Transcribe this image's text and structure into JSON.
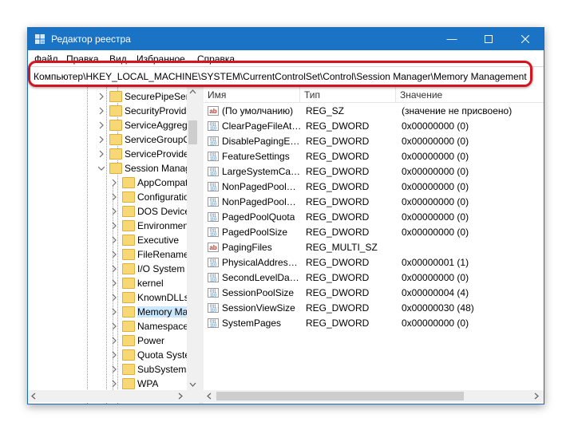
{
  "window": {
    "title": "Редактор реестра"
  },
  "menu": {
    "items": [
      "Файл",
      "Правка",
      "Вид",
      "Избранное",
      "Справка"
    ]
  },
  "address": {
    "path": "Компьютер\\HKEY_LOCAL_MACHINE\\SYSTEM\\CurrentControlSet\\Control\\Session Manager\\Memory Management"
  },
  "tree": {
    "items": [
      {
        "label": "SecurePipeServers"
      },
      {
        "label": "SecurityProviders"
      },
      {
        "label": "ServiceAggregatedEvents"
      },
      {
        "label": "ServiceGroupOrder"
      },
      {
        "label": "ServiceProvider"
      },
      {
        "label": "Session Manager"
      },
      {
        "label": "AppCompatCache"
      },
      {
        "label": "Configuration Manager"
      },
      {
        "label": "DOS Devices"
      },
      {
        "label": "Environment"
      },
      {
        "label": "Executive"
      },
      {
        "label": "FileRenameOperations"
      },
      {
        "label": "I/O System"
      },
      {
        "label": "kernel"
      },
      {
        "label": "KnownDLLs"
      },
      {
        "label": "Memory Management"
      },
      {
        "label": "Namespace Separation"
      },
      {
        "label": "Power"
      },
      {
        "label": "Quota System"
      },
      {
        "label": "SubSystems"
      },
      {
        "label": "WPA"
      }
    ]
  },
  "list": {
    "columns": {
      "name": "Имя",
      "type": "Тип",
      "value": "Значение"
    },
    "rows": [
      {
        "icon": "string-value-icon",
        "name": "(По умолчанию)",
        "type": "REG_SZ",
        "value": "(значение не присвоено)"
      },
      {
        "icon": "binary-value-icon",
        "name": "ClearPageFileAtShutdown",
        "type": "REG_DWORD",
        "value": "0x00000000 (0)"
      },
      {
        "icon": "binary-value-icon",
        "name": "DisablePagingExecutive",
        "type": "REG_DWORD",
        "value": "0x00000000 (0)"
      },
      {
        "icon": "binary-value-icon",
        "name": "FeatureSettings",
        "type": "REG_DWORD",
        "value": "0x00000000 (0)"
      },
      {
        "icon": "binary-value-icon",
        "name": "LargeSystemCache",
        "type": "REG_DWORD",
        "value": "0x00000000 (0)"
      },
      {
        "icon": "binary-value-icon",
        "name": "NonPagedPoolQuota",
        "type": "REG_DWORD",
        "value": "0x00000000 (0)"
      },
      {
        "icon": "binary-value-icon",
        "name": "NonPagedPoolSize",
        "type": "REG_DWORD",
        "value": "0x00000000 (0)"
      },
      {
        "icon": "binary-value-icon",
        "name": "PagedPoolQuota",
        "type": "REG_DWORD",
        "value": "0x00000000 (0)"
      },
      {
        "icon": "binary-value-icon",
        "name": "PagedPoolSize",
        "type": "REG_DWORD",
        "value": "0x00000000 (0)"
      },
      {
        "icon": "string-value-icon",
        "name": "PagingFiles",
        "type": "REG_MULTI_SZ",
        "value": ""
      },
      {
        "icon": "binary-value-icon",
        "name": "PhysicalAddressExtension",
        "type": "REG_DWORD",
        "value": "0x00000001 (1)"
      },
      {
        "icon": "binary-value-icon",
        "name": "SecondLevelDataCache",
        "type": "REG_DWORD",
        "value": "0x00000000 (0)"
      },
      {
        "icon": "binary-value-icon",
        "name": "SessionPoolSize",
        "type": "REG_DWORD",
        "value": "0x00000004 (4)"
      },
      {
        "icon": "binary-value-icon",
        "name": "SessionViewSize",
        "type": "REG_DWORD",
        "value": "0x00000030 (48)"
      },
      {
        "icon": "binary-value-icon",
        "name": "SystemPages",
        "type": "REG_DWORD",
        "value": "0x00000000 (0)"
      }
    ]
  },
  "colors": {
    "titlebar": "#1a73c4",
    "highlight": "#d4151f",
    "selection": "#cce8ff",
    "folder": "#f8d775"
  }
}
